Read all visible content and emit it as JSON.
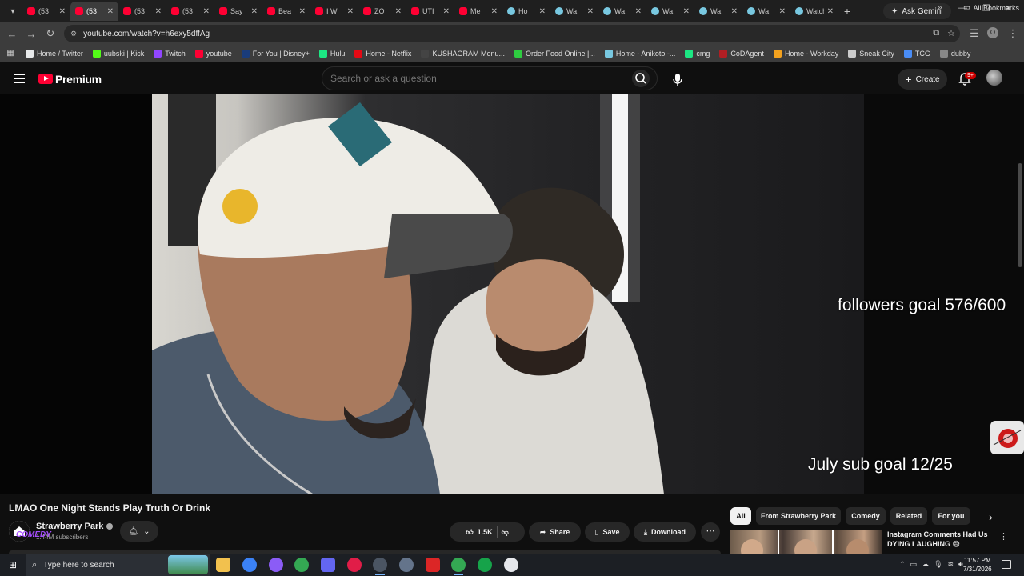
{
  "browser": {
    "tabs": [
      {
        "label": "(53",
        "favicon": "youtube-icon",
        "active": false
      },
      {
        "label": "(53",
        "favicon": "youtube-icon",
        "active": true
      },
      {
        "label": "(53",
        "favicon": "youtube-icon",
        "active": false
      },
      {
        "label": "(53",
        "favicon": "youtube-icon",
        "active": false
      },
      {
        "label": "Say",
        "favicon": "youtube-icon",
        "active": false
      },
      {
        "label": "Bea",
        "favicon": "youtube-icon",
        "active": false
      },
      {
        "label": "I W",
        "favicon": "youtube-icon",
        "active": false
      },
      {
        "label": "ZO",
        "favicon": "youtube-icon",
        "active": false
      },
      {
        "label": "UTI",
        "favicon": "youtube-icon",
        "active": false
      },
      {
        "label": "Me",
        "favicon": "youtube-icon",
        "active": false
      },
      {
        "label": "Ho",
        "favicon": "globe-icon",
        "active": false
      },
      {
        "label": "Wa",
        "favicon": "globe-icon",
        "active": false
      },
      {
        "label": "Wa",
        "favicon": "globe-icon",
        "active": false
      },
      {
        "label": "Wa",
        "favicon": "globe-icon",
        "active": false
      },
      {
        "label": "Wa",
        "favicon": "globe-icon",
        "active": false
      },
      {
        "label": "Wa",
        "favicon": "globe-icon",
        "active": false
      },
      {
        "label": "Watch T",
        "favicon": "globe-icon",
        "active": false
      }
    ],
    "new_tab": "+",
    "gemini_label": "Ask Gemini",
    "url": "youtube.com/watch?v=h6exy5dffAg",
    "profile_initial": "O",
    "bookmarks": [
      {
        "label": "Home / Twitter",
        "color": "#e7e9ea"
      },
      {
        "label": "uubski | Kick",
        "color": "#53fc18"
      },
      {
        "label": "Twitch",
        "color": "#9146ff"
      },
      {
        "label": "youtube",
        "color": "#ff0033"
      },
      {
        "label": "For You | Disney+",
        "color": "#1a3c7a"
      },
      {
        "label": "Hulu",
        "color": "#1ce783"
      },
      {
        "label": "Home - Netflix",
        "color": "#e50914"
      },
      {
        "label": "KUSHAGRAM Menu...",
        "color": "#444444"
      },
      {
        "label": "Order Food Online |...",
        "color": "#2ecc40"
      },
      {
        "label": "Home - Anikoto -...",
        "color": "#78c8e0"
      },
      {
        "label": "cmg",
        "color": "#1ce783"
      },
      {
        "label": "CoDAgent",
        "color": "#b01e23"
      },
      {
        "label": "Home - Workday",
        "color": "#f4a21e"
      },
      {
        "label": "Sneak City",
        "color": "#cccccc"
      },
      {
        "label": "TCG",
        "color": "#4a8df6"
      },
      {
        "label": "dubby",
        "color": "#888888"
      }
    ],
    "all_bookmarks": "All Bookmarks"
  },
  "youtube": {
    "brand": "Premium",
    "search_placeholder": "Search or ask a question",
    "create_label": "Create",
    "notification_count": "9+",
    "overlay_followers": "followers goal 576/600",
    "overlay_sub": "July sub goal 12/25",
    "video_title": "LMAO One Night Stands Play Truth Or Drink",
    "channel_name": "Strawberry Park",
    "subscribers": "1.44M subscribers",
    "overlay_tag": "COMEDY",
    "likes": "1.5K",
    "share_label": "Share",
    "save_label": "Save",
    "download_label": "Download",
    "chips": [
      "All",
      "From Strawberry Park",
      "Comedy",
      "Related",
      "For you"
    ],
    "recommendation_title": "Instagram Comments Had Us DYING LAUGHING 😅"
  },
  "taskbar": {
    "search_placeholder": "Type here to search",
    "time": "11:57 PM",
    "date": "7/31/2026"
  },
  "colors": {
    "youtube_red": "#ff0033",
    "background": "#0f0f0f",
    "chip_bg": "#272727"
  }
}
